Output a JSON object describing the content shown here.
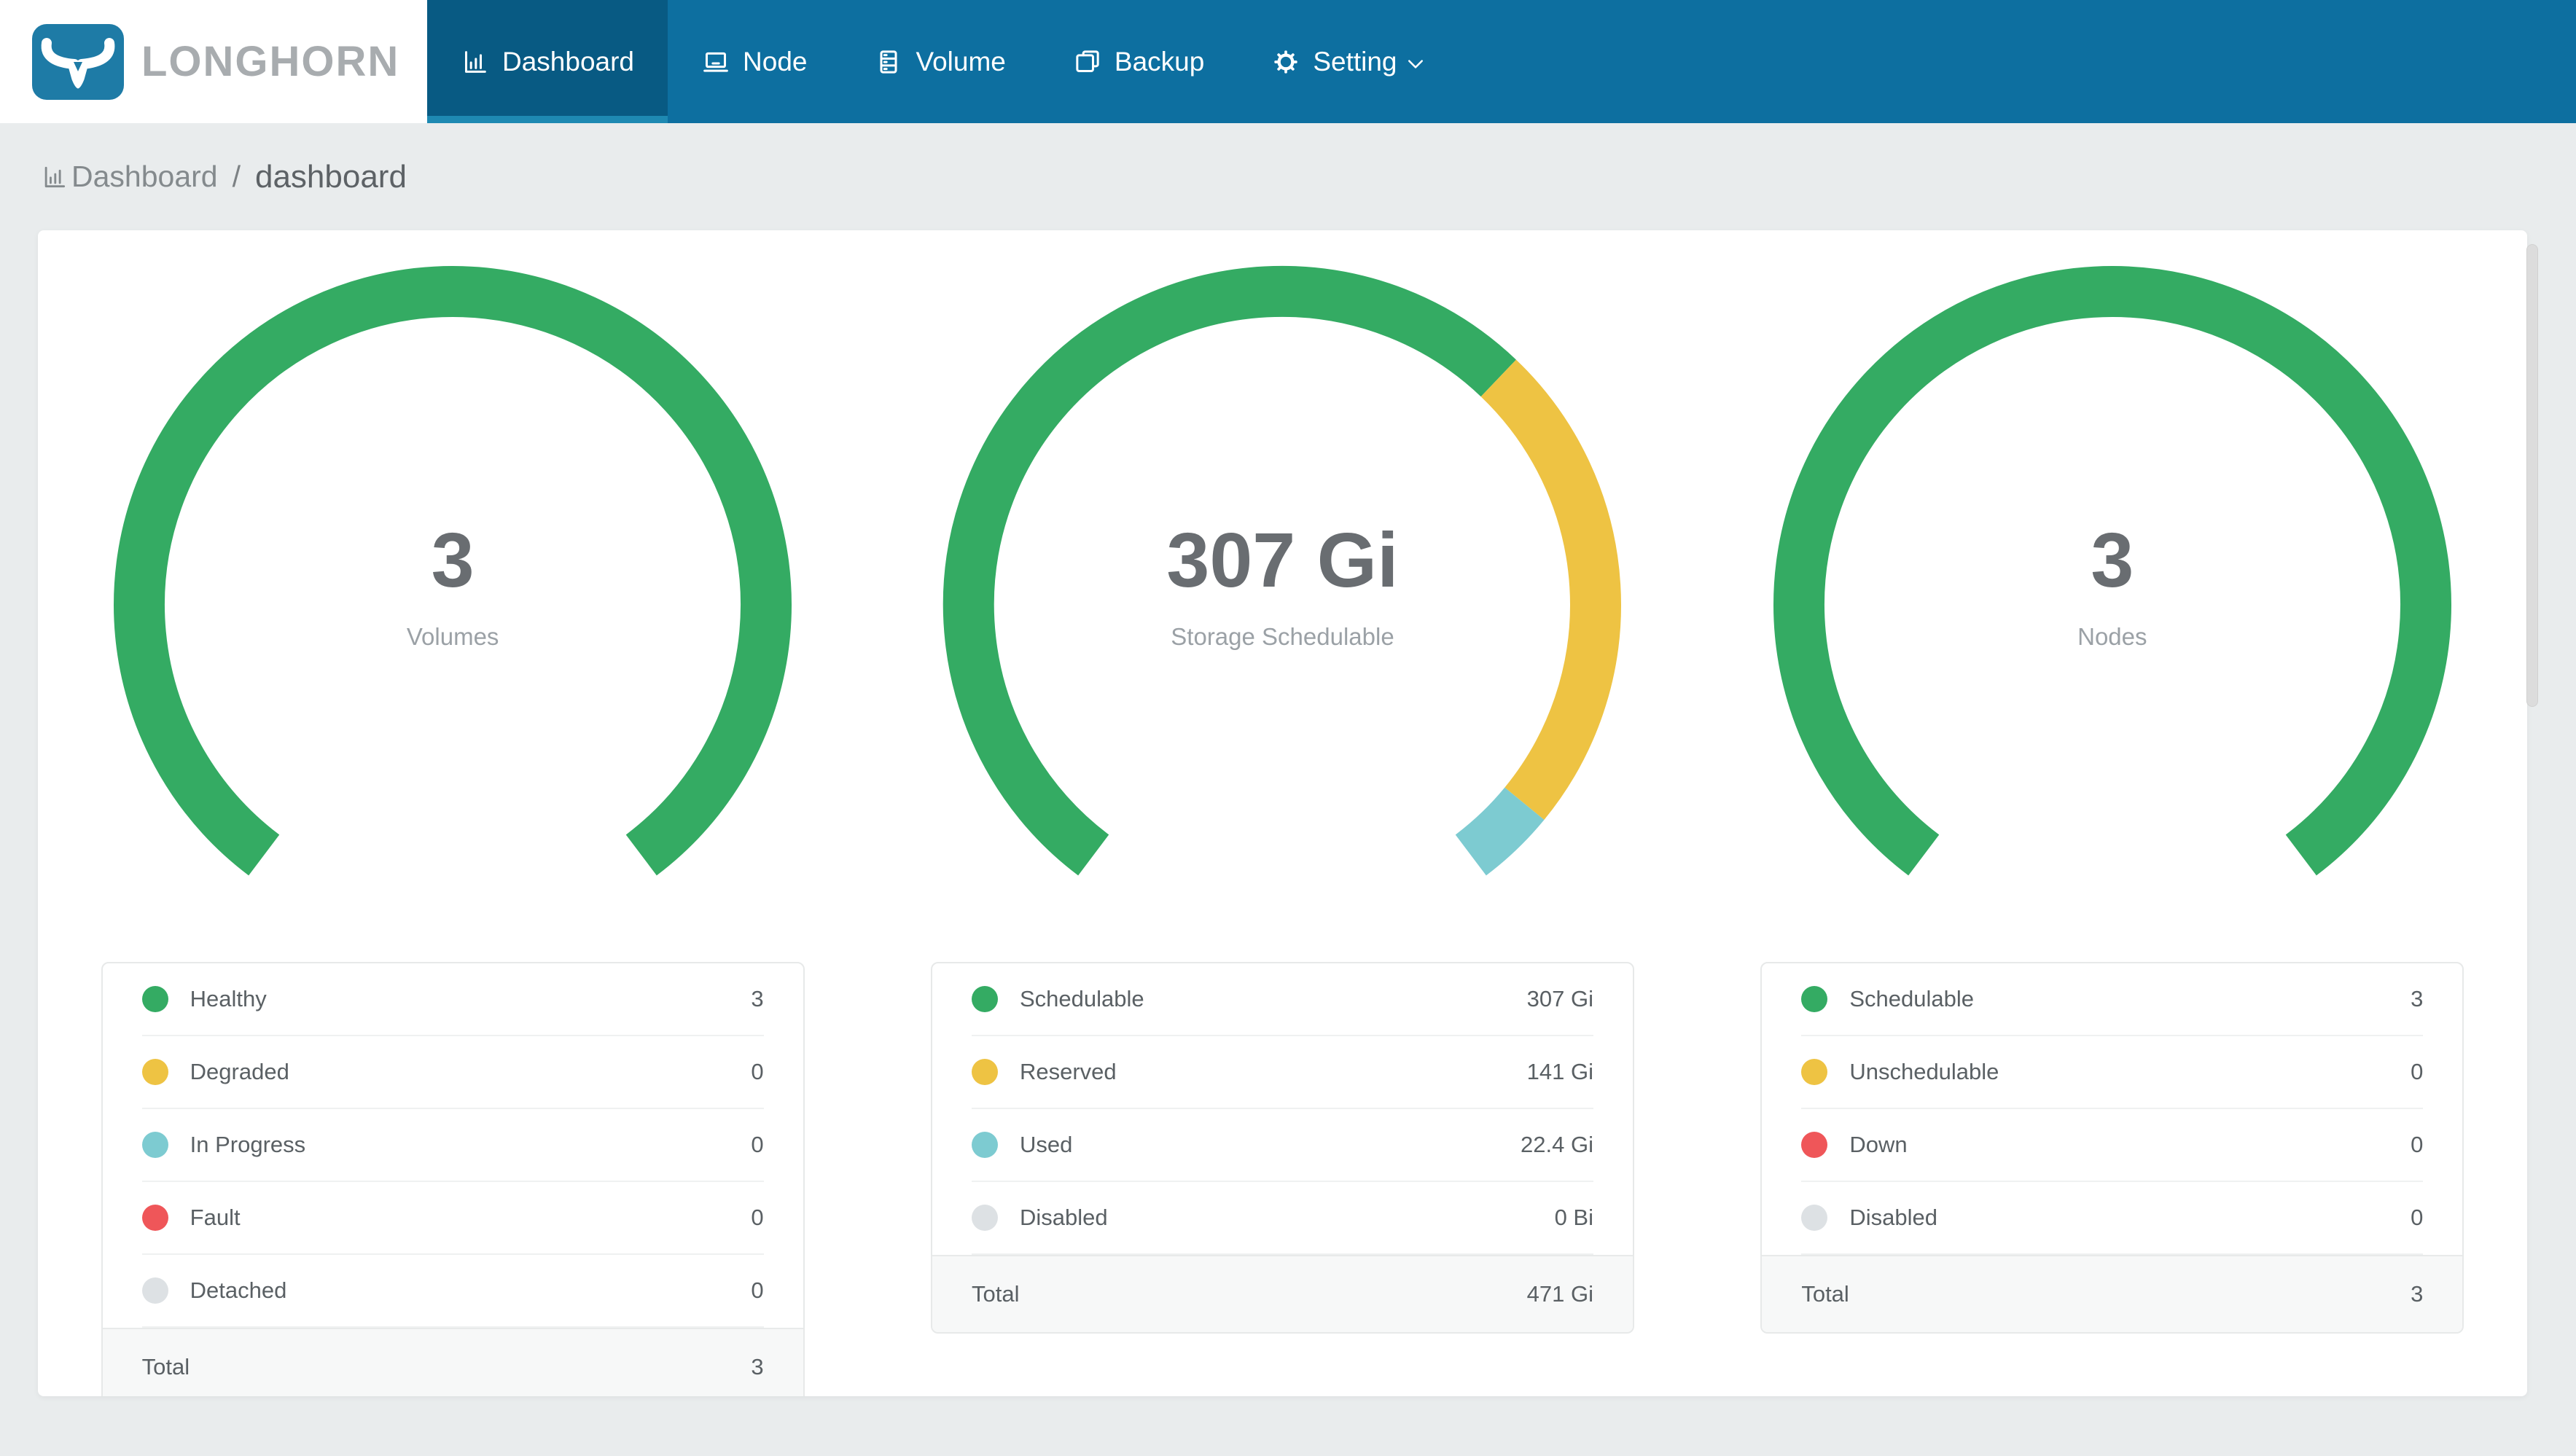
{
  "nav": {
    "brand": "LONGHORN",
    "items": [
      {
        "label": "Dashboard",
        "icon": "bar-chart-icon",
        "active": true
      },
      {
        "label": "Node",
        "icon": "laptop-icon",
        "active": false
      },
      {
        "label": "Volume",
        "icon": "database-icon",
        "active": false
      },
      {
        "label": "Backup",
        "icon": "copy-icon",
        "active": false
      },
      {
        "label": "Setting",
        "icon": "gear-icon",
        "active": false,
        "dropdown": true
      }
    ]
  },
  "breadcrumb": {
    "section": "Dashboard",
    "separator": "/",
    "page": "dashboard"
  },
  "colors": {
    "navbar": "#0d6fa0",
    "navbar_active": "#085a83",
    "active_underline": "#1e89b2",
    "logo_blue": "#1e7ba6",
    "brand_text": "#a8acaf",
    "page_bg": "#e9eced",
    "green": "#34ab63",
    "yellow": "#eec343",
    "teal": "#7dcbd1",
    "red": "#ef5659",
    "gray": "#dde1e4",
    "value_text": "#696d71",
    "muted_text": "#9ba1a6",
    "legend_text": "#5a6064"
  },
  "chart_data": [
    {
      "type": "gauge",
      "center_value": "3",
      "center_label": "Volumes",
      "start_angle": -143,
      "sweep": 286,
      "total_label": "Total",
      "total_value": "3",
      "segments": [
        {
          "label": "Healthy",
          "value": "3",
          "share": 3,
          "color": "#34ab63"
        },
        {
          "label": "Degraded",
          "value": "0",
          "share": 0,
          "color": "#eec343"
        },
        {
          "label": "In Progress",
          "value": "0",
          "share": 0,
          "color": "#7dcbd1"
        },
        {
          "label": "Fault",
          "value": "0",
          "share": 0,
          "color": "#ef5659"
        },
        {
          "label": "Detached",
          "value": "0",
          "share": 0,
          "color": "#dde1e4"
        }
      ]
    },
    {
      "type": "gauge",
      "center_value": "307 Gi",
      "center_label": "Storage Schedulable",
      "start_angle": -143,
      "sweep": 286,
      "total_label": "Total",
      "total_value": "471 Gi",
      "segments": [
        {
          "label": "Schedulable",
          "value": "307 Gi",
          "share": 307,
          "color": "#34ab63"
        },
        {
          "label": "Reserved",
          "value": "141 Gi",
          "share": 141,
          "color": "#eec343"
        },
        {
          "label": "Used",
          "value": "22.4 Gi",
          "share": 22.4,
          "color": "#7dcbd1"
        },
        {
          "label": "Disabled",
          "value": "0 Bi",
          "share": 0,
          "color": "#dde1e4"
        }
      ]
    },
    {
      "type": "gauge",
      "center_value": "3",
      "center_label": "Nodes",
      "start_angle": -143,
      "sweep": 286,
      "total_label": "Total",
      "total_value": "3",
      "segments": [
        {
          "label": "Schedulable",
          "value": "3",
          "share": 3,
          "color": "#34ab63"
        },
        {
          "label": "Unschedulable",
          "value": "0",
          "share": 0,
          "color": "#eec343"
        },
        {
          "label": "Down",
          "value": "0",
          "share": 0,
          "color": "#ef5659"
        },
        {
          "label": "Disabled",
          "value": "0",
          "share": 0,
          "color": "#dde1e4"
        }
      ]
    }
  ]
}
